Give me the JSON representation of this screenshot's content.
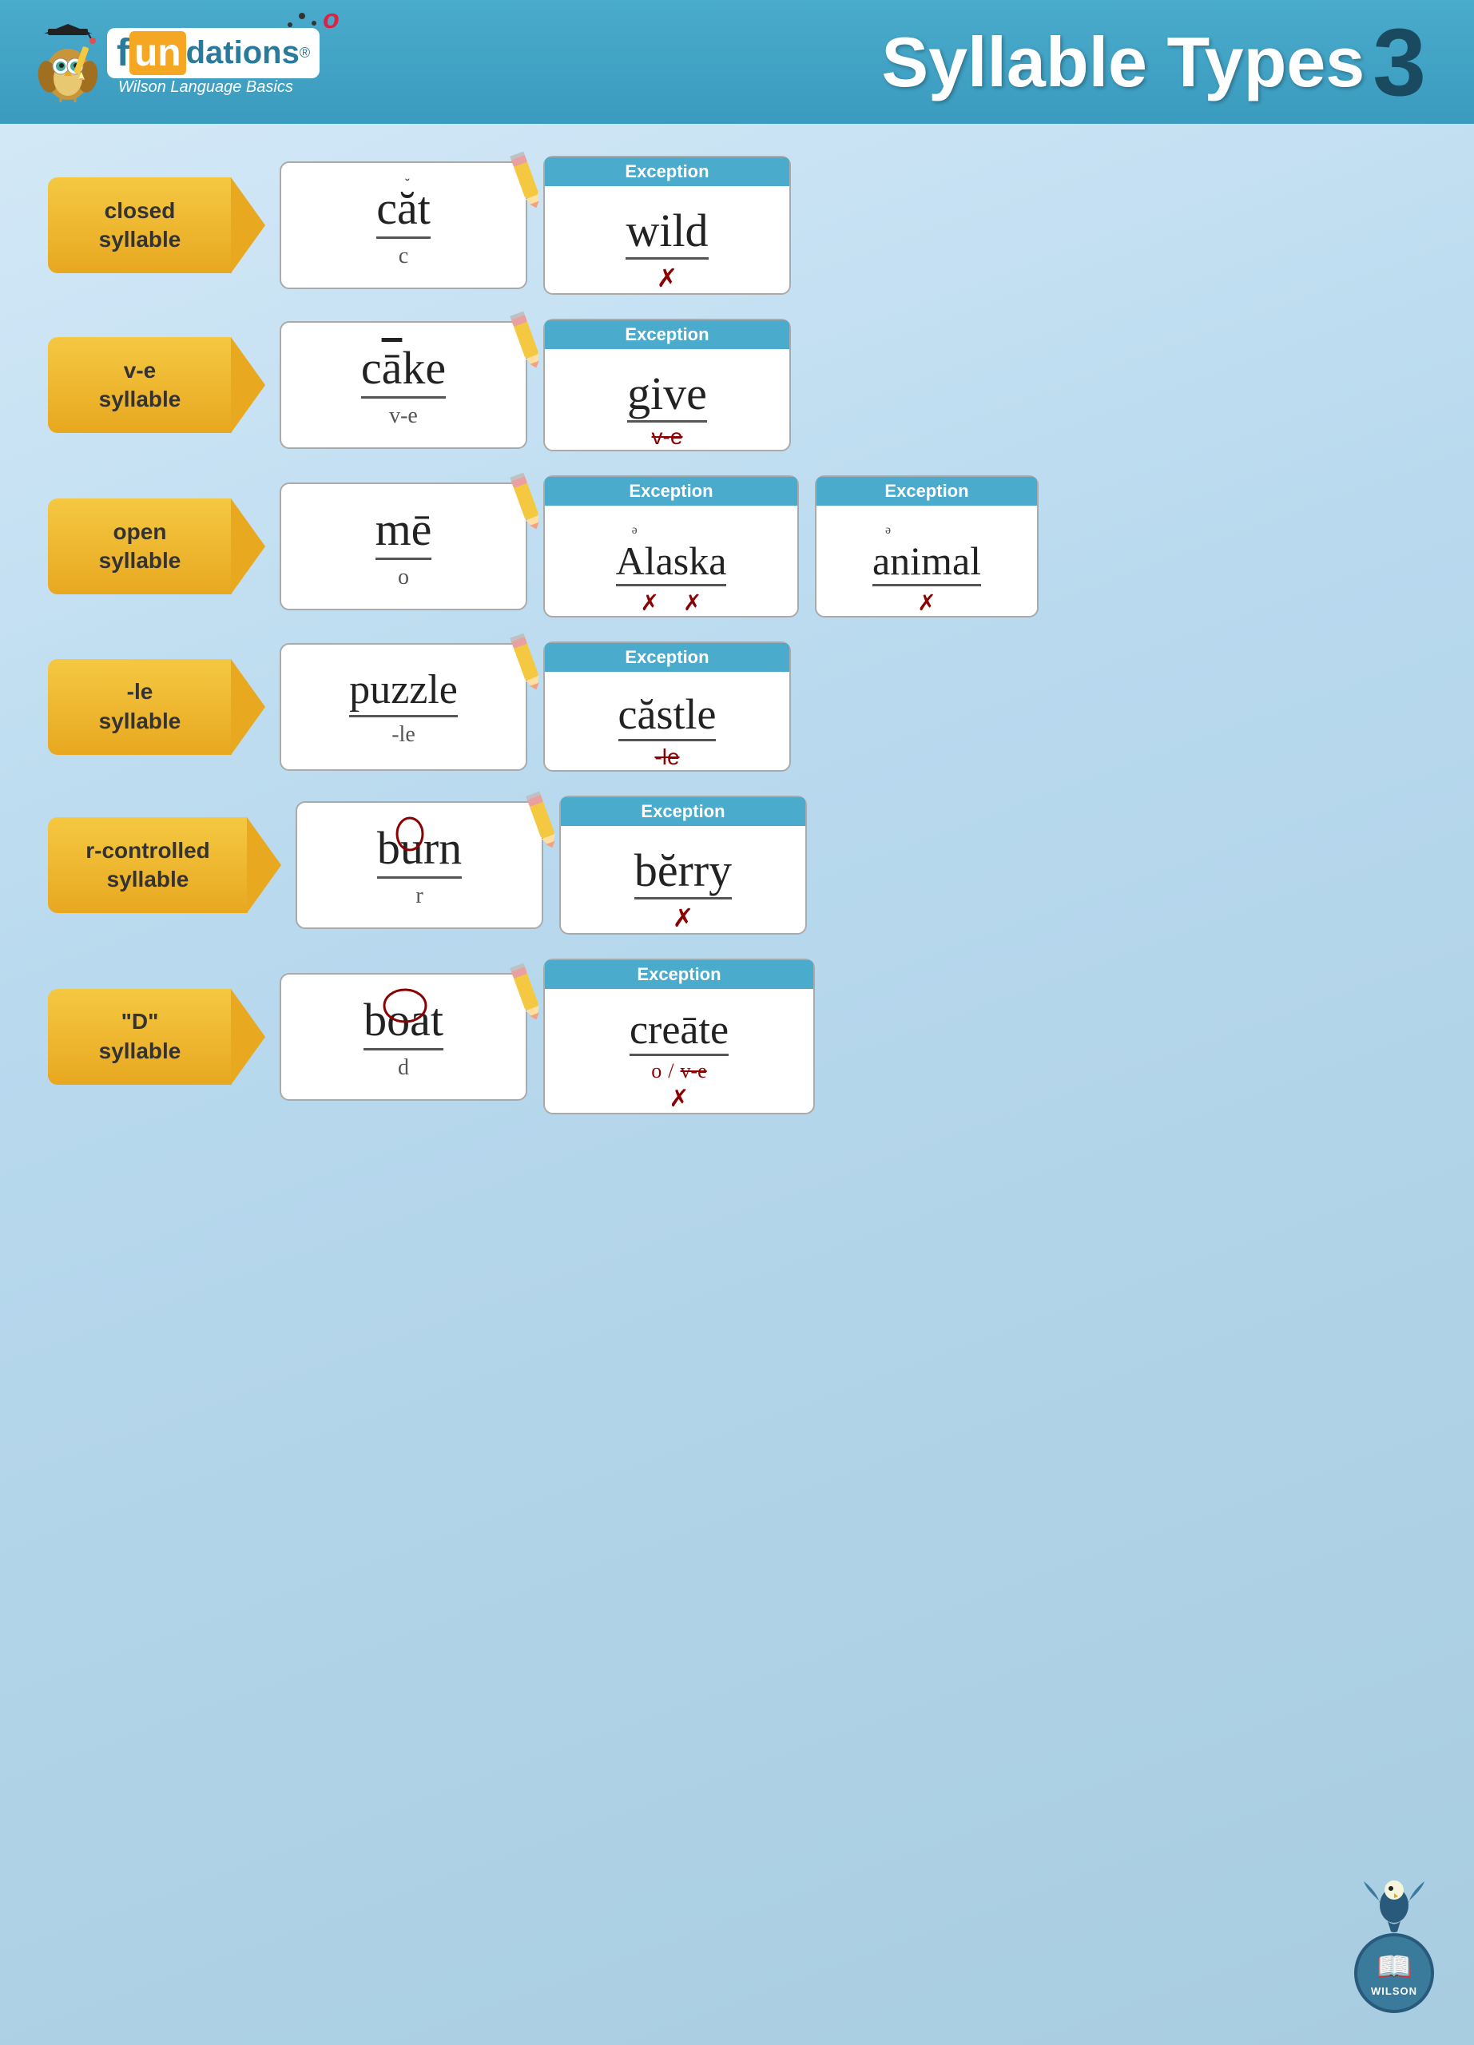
{
  "header": {
    "title": "Syllable Types",
    "number": "3",
    "logo_name": "fundations",
    "logo_reg": "®",
    "subtitle": "Wilson Language Basics"
  },
  "syllable_types": [
    {
      "id": "closed",
      "label": "closed\nsyllable",
      "example_word": "căt",
      "example_display": "c̆at",
      "example_label": "c",
      "has_pencil": true,
      "exception": {
        "word": "wild",
        "label": "crossed-c",
        "header": "Exception"
      }
    },
    {
      "id": "ve",
      "label": "v-e\nsyllable",
      "example_word": "cāke",
      "example_display": "cāke",
      "example_label": "v-e",
      "has_pencil": true,
      "exception": {
        "word": "give",
        "label": "v-e crossed",
        "header": "Exception"
      }
    },
    {
      "id": "open",
      "label": "open\nsyllable",
      "example_word": "mē",
      "example_display": "mē",
      "example_label": "o",
      "has_pencil": true,
      "exceptions": [
        {
          "word": "Ålaska",
          "display": "əAlaska",
          "label": "crossed x2",
          "header": "Exception"
        },
        {
          "word": "animal",
          "display": "əanimal",
          "label": "crossed",
          "header": "Exception"
        }
      ]
    },
    {
      "id": "le",
      "label": "-le\nsyllable",
      "example_word": "puzzle",
      "example_display": "puzzle",
      "example_label": "-le",
      "has_pencil": true,
      "exception": {
        "word": "castle",
        "display": "căstle",
        "label": "crossed -le",
        "header": "Exception"
      }
    },
    {
      "id": "rcontrolled",
      "label": "r-controlled\nsyllable",
      "example_word": "burn",
      "example_display": "burn",
      "example_label": "r",
      "has_pencil": true,
      "exception": {
        "word": "berry",
        "display": "bĕrry",
        "label": "crossed r",
        "header": "Exception"
      }
    },
    {
      "id": "d",
      "label": "\"D\"\nsyllable",
      "example_word": "boat",
      "example_display": "boat",
      "example_label": "d",
      "has_pencil": true,
      "exception": {
        "word": "create",
        "display": "creāte",
        "label": "o / v-e crossed",
        "header": "Exception"
      }
    }
  ],
  "wilson": {
    "label": "WILSON"
  }
}
